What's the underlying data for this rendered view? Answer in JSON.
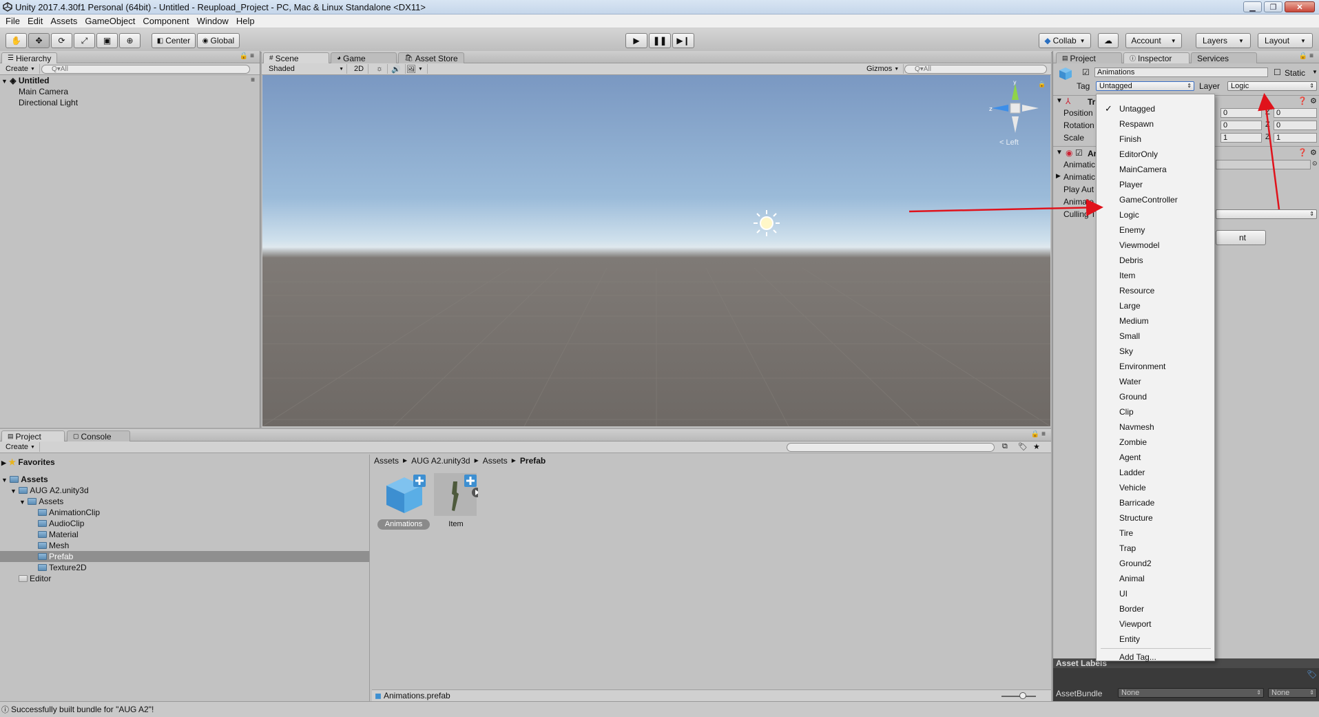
{
  "window": {
    "title": "Unity 2017.4.30f1 Personal (64bit) - Untitled - Reupload_Project - PC, Mac & Linux Standalone <DX11>"
  },
  "menu": [
    "File",
    "Edit",
    "Assets",
    "GameObject",
    "Component",
    "Window",
    "Help"
  ],
  "toolbar": {
    "pivot": "Center",
    "space": "Global",
    "collab": "Collab",
    "account": "Account",
    "layers": "Layers",
    "layout": "Layout"
  },
  "hierarchy": {
    "tab": "Hierarchy",
    "create": "Create",
    "search_placeholder": "Q▾All",
    "scene": "Untitled",
    "items": [
      "Main Camera",
      "Directional Light"
    ]
  },
  "scene": {
    "tabs": [
      "Scene",
      "Game",
      "Asset Store"
    ],
    "shading": "Shaded",
    "mode2d": "2D",
    "gizmos": "Gizmos",
    "search_placeholder": "Q▾All",
    "gizmo_label": "< Left"
  },
  "project": {
    "tabs": [
      "Project",
      "Console"
    ],
    "create": "Create",
    "favorites": "Favorites",
    "assets_root": "Assets",
    "tree": [
      "AUG A2.unity3d",
      "Assets",
      "AnimationClip",
      "AudioClip",
      "Material",
      "Mesh",
      "Prefab",
      "Texture2D",
      "Editor"
    ],
    "breadcrumb": [
      "Assets",
      "AUG A2.unity3d",
      "Assets",
      "Prefab"
    ],
    "files": [
      "Animations",
      "Item"
    ],
    "selected_file": "Animations.prefab"
  },
  "inspector": {
    "tabs": [
      "Project",
      "Inspector",
      "Services"
    ],
    "object_name": "Animations",
    "static_label": "Static",
    "tag_label": "Tag",
    "tag_value": "Untagged",
    "layer_label": "Layer",
    "layer_value": "Logic",
    "transform": "Tr",
    "position": "Position",
    "rotation": "Rotation",
    "scale": "Scale",
    "pos_y": "0",
    "pos_z": "0",
    "rot_y": "0",
    "rot_z": "0",
    "scale_y": "1",
    "scale_z": "1",
    "z_label": "Z",
    "animation_comp": "Ar",
    "rows": [
      "Animatic",
      "Animatic",
      "Play Aut",
      "Animate",
      "Culling T"
    ],
    "button_fragment": "nt",
    "asset_labels": "Asset Labels",
    "asset_bundle": "AssetBundle",
    "bundle_value": "None",
    "bundle_variant": "None"
  },
  "tag_options": [
    "Untagged",
    "Respawn",
    "Finish",
    "EditorOnly",
    "MainCamera",
    "Player",
    "GameController",
    "Logic",
    "Enemy",
    "Viewmodel",
    "Debris",
    "Item",
    "Resource",
    "Large",
    "Medium",
    "Small",
    "Sky",
    "Environment",
    "Water",
    "Ground",
    "Clip",
    "Navmesh",
    "Zombie",
    "Agent",
    "Ladder",
    "Vehicle",
    "Barricade",
    "Structure",
    "Tire",
    "Trap",
    "Ground2",
    "Animal",
    "UI",
    "Border",
    "Viewport",
    "Entity"
  ],
  "add_tag": "Add Tag...",
  "status": {
    "message": "Successfully built bundle for \"AUG A2\"!"
  },
  "colors": {
    "accent_red": "#e0121b",
    "selection": "#8f8f8f"
  }
}
